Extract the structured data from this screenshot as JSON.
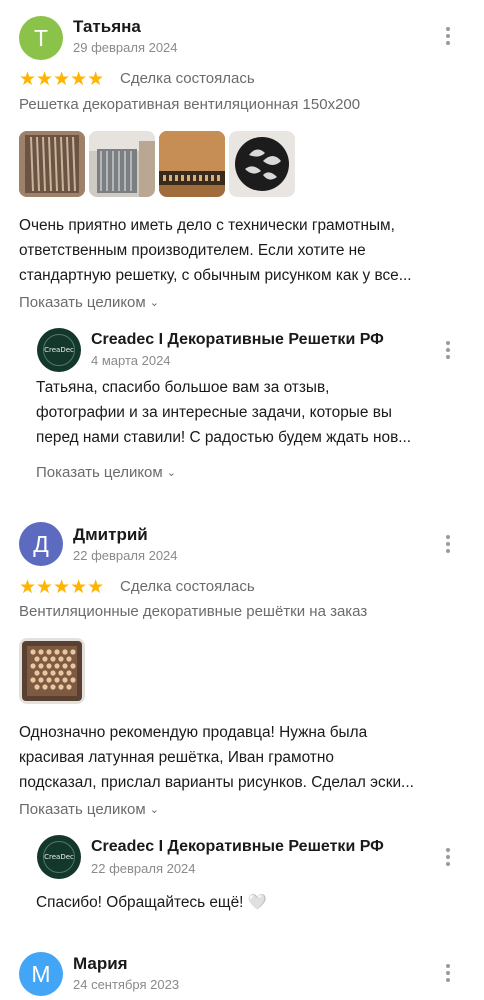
{
  "reviews": [
    {
      "avatar_letter": "Т",
      "avatar_color": "#8bc34a",
      "name": "Татьяна",
      "date": "29 февраля 2024",
      "stars": "★★★★★",
      "deal_status": "Сделка состоялась",
      "product": "Решетка декоративная вентиляционная 150х200",
      "text_lines": [
        "Очень приятно иметь дело с технически грамотным,",
        "ответственным производителем. Если хотите не",
        "стандартную решетку, с обычным рисунком как у все..."
      ],
      "show_more": "Показать целиком",
      "reply": {
        "name": "Creadec I Декоративные Решетки РФ",
        "logo_text": "CreaDec",
        "date": "4 марта 2024",
        "text_lines": [
          "Татьяна, спасибо большое вам за отзыв,",
          "фотографии и за интересные задачи, которые вы",
          "перед нами ставили! С радостью будем ждать нов..."
        ],
        "show_more": "Показать целиком"
      }
    },
    {
      "avatar_letter": "Д",
      "avatar_color": "#5c6bc0",
      "name": "Дмитрий",
      "date": "22 февраля 2024",
      "stars": "★★★★★",
      "deal_status": "Сделка состоялась",
      "product": "Вентиляционные декоративные решётки на заказ",
      "text_lines": [
        "Однозначно рекомендую продавца! Нужна была",
        "красивая латунная решётка, Иван грамотно",
        "подсказал, прислал варианты рисунков. Сделал эски..."
      ],
      "show_more": "Показать целиком",
      "reply": {
        "name": "Creadec I Декоративные Решетки РФ",
        "logo_text": "CreaDec",
        "date": "22 февраля 2024",
        "text": "Спасибо! Обращайтесь ещё!",
        "emoji": "🤍"
      }
    },
    {
      "avatar_letter": "М",
      "avatar_color": "#42a5f5",
      "name": "Мария",
      "date": "24 сентября 2023"
    }
  ],
  "colors": {
    "star": "#ffb400",
    "muted_text": "#6b6b6b",
    "date_text": "#8a8a8a",
    "logo_bg": "#14372c"
  },
  "icons": [
    "more-vertical-icon",
    "chevron-down-icon",
    "star-icon",
    "heart-emoji"
  ]
}
